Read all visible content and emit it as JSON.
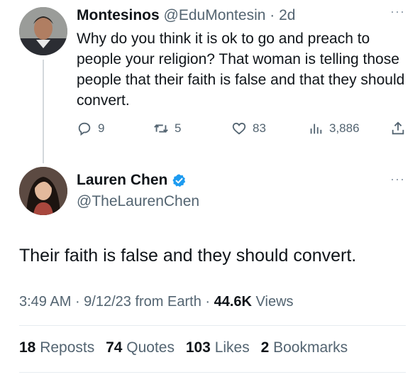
{
  "parent_tweet": {
    "display_name": "Montesinos",
    "handle": "@EduMontesin",
    "separator": "·",
    "time": "2d",
    "more": "···",
    "text": "Why do you think it is ok to go and preach to people your religion? That woman is telling those people that their faith is false and that they should convert.",
    "actions": {
      "replies": "9",
      "reposts": "5",
      "likes": "83",
      "views": "3,886"
    }
  },
  "main_tweet": {
    "display_name": "Lauren Chen",
    "handle": "@TheLaurenChen",
    "more": "···",
    "text": "Their faith is false and they should convert.",
    "meta": {
      "time": "3:49 AM",
      "sep1": " · ",
      "date": "9/12/23",
      "source": " from Earth",
      "sep2": " · ",
      "views_count": "44.6K",
      "views_label": " Views"
    },
    "stats": [
      {
        "num": "18",
        "label": " Reposts"
      },
      {
        "num": "74",
        "label": " Quotes"
      },
      {
        "num": "103",
        "label": " Likes"
      },
      {
        "num": "2",
        "label": " Bookmarks"
      }
    ]
  },
  "colors": {
    "verified": "#1d9bf0",
    "secondary_text": "#536471",
    "primary_text": "#0f1419"
  },
  "icons": [
    "reply-icon",
    "repost-icon",
    "like-icon",
    "views-icon",
    "share-icon",
    "verified-badge-icon",
    "more-icon"
  ]
}
